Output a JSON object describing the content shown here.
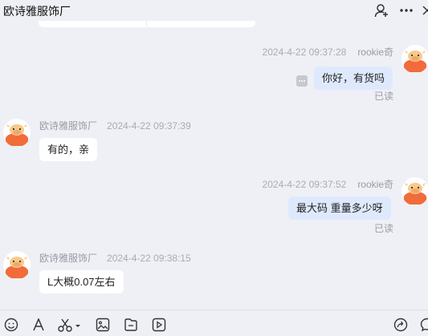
{
  "header": {
    "title": "欧诗雅服饰厂",
    "icons": [
      "add-user-icon",
      "more-icon",
      "close-icon"
    ]
  },
  "messages": [
    {
      "side": "mine",
      "time": "2024-4-22 09:37:28",
      "sender": "rookie奇",
      "text": "你好，有货吗",
      "status": "已读"
    },
    {
      "side": "theirs",
      "time": "2024-4-22 09:37:39",
      "sender": "欧诗雅服饰厂",
      "text": "有的，亲"
    },
    {
      "side": "mine",
      "time": "2024-4-22 09:37:52",
      "sender": "rookie奇",
      "text": "最大码 重量多少呀",
      "status": "已读"
    },
    {
      "side": "theirs",
      "time": "2024-4-22 09:38:15",
      "sender": "欧诗雅服饰厂",
      "text": "L大概0.07左右"
    }
  ],
  "toolbar": {
    "icons": [
      "emoji-icon",
      "font-icon",
      "scissors-icon",
      "image-icon",
      "file-icon",
      "video-icon",
      "share-icon",
      "chat-icon"
    ]
  },
  "colors": {
    "background": "#eef0f5",
    "my_bubble": "#dfe9fd",
    "their_bubble": "#ffffff",
    "avatar_orange": "#f26b3a"
  }
}
